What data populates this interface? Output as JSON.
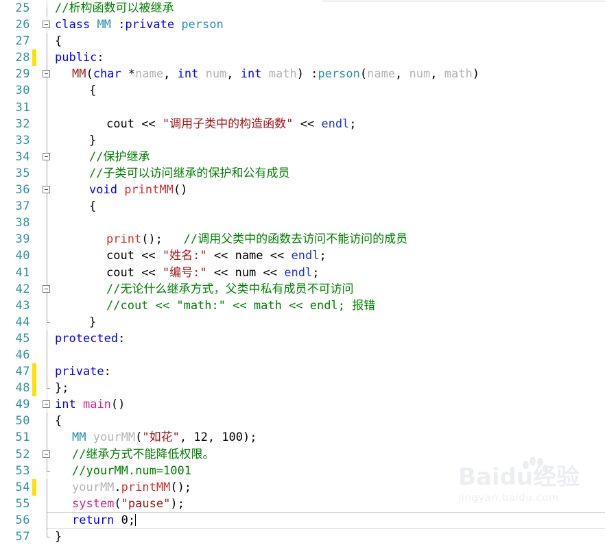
{
  "app": {
    "type": "code-editor",
    "language": "C++",
    "theme": "visual-studio-light"
  },
  "colors": {
    "keyword": "#0000FF",
    "comment": "#008000",
    "string": "#A31515",
    "user_type": "#2B91AF",
    "identifier_gray": "#B4B4B4",
    "member_function": "#D63030",
    "magenta_function": "#D2228D",
    "line_number": "#2B91AF",
    "change_bar": "#FFE100",
    "background": "#FFFFFF",
    "plain_text": "#000000"
  },
  "editor": {
    "first_line": 25,
    "last_line": 57,
    "current_line": 56,
    "caret_line": 56,
    "caret_after_text": "return 0;"
  },
  "lines": [
    {
      "num": "25",
      "fold": "none",
      "rail": "half-bot",
      "changed": false,
      "indent": 0,
      "tokens": [
        {
          "t": "//析构函数可以被继承",
          "c": "cmt"
        }
      ]
    },
    {
      "num": "26",
      "fold": "box",
      "rail": "none",
      "changed": false,
      "indent": 0,
      "tokens": [
        {
          "t": "class",
          "c": "kw"
        },
        {
          "t": " ",
          "c": "pln"
        },
        {
          "t": "MM",
          "c": "typ"
        },
        {
          "t": " :",
          "c": "pln"
        },
        {
          "t": "private",
          "c": "kw"
        },
        {
          "t": " ",
          "c": "pln"
        },
        {
          "t": "person",
          "c": "typ"
        }
      ]
    },
    {
      "num": "27",
      "fold": "line",
      "rail": "full",
      "changed": false,
      "indent": 0,
      "tokens": [
        {
          "t": "{",
          "c": "pln"
        }
      ]
    },
    {
      "num": "28",
      "fold": "line",
      "rail": "full",
      "changed": true,
      "indent": 0,
      "tokens": [
        {
          "t": "public",
          "c": "kw"
        },
        {
          "t": ":",
          "c": "pln"
        }
      ]
    },
    {
      "num": "29",
      "fold": "box",
      "rail": "full",
      "changed": false,
      "indent": 1,
      "tokens": [
        {
          "t": "MM",
          "c": "cls"
        },
        {
          "t": "(",
          "c": "pln"
        },
        {
          "t": "char",
          "c": "kw"
        },
        {
          "t": " *",
          "c": "pln"
        },
        {
          "t": "name",
          "c": "typ2"
        },
        {
          "t": ", ",
          "c": "pln"
        },
        {
          "t": "int",
          "c": "kw"
        },
        {
          "t": " ",
          "c": "pln"
        },
        {
          "t": "num",
          "c": "typ2"
        },
        {
          "t": ", ",
          "c": "pln"
        },
        {
          "t": "int",
          "c": "kw"
        },
        {
          "t": " ",
          "c": "pln"
        },
        {
          "t": "math",
          "c": "typ2"
        },
        {
          "t": ") :",
          "c": "pln"
        },
        {
          "t": "person",
          "c": "typ"
        },
        {
          "t": "(",
          "c": "pln"
        },
        {
          "t": "name",
          "c": "typ2"
        },
        {
          "t": ", ",
          "c": "pln"
        },
        {
          "t": "num",
          "c": "typ2"
        },
        {
          "t": ", ",
          "c": "pln"
        },
        {
          "t": "math",
          "c": "typ2"
        },
        {
          "t": ")",
          "c": "pln"
        }
      ]
    },
    {
      "num": "30",
      "fold": "line",
      "rail": "full",
      "changed": false,
      "indent": 2,
      "tokens": [
        {
          "t": "{",
          "c": "pln"
        }
      ]
    },
    {
      "num": "31",
      "fold": "line",
      "rail": "full",
      "changed": false,
      "indent": 0,
      "tokens": []
    },
    {
      "num": "32",
      "fold": "line",
      "rail": "full",
      "changed": false,
      "indent": 3,
      "tokens": [
        {
          "t": "cout",
          "c": "pln"
        },
        {
          "t": " << ",
          "c": "pln"
        },
        {
          "t": "\"调用子类中的构造函数\"",
          "c": "str"
        },
        {
          "t": " << ",
          "c": "pln"
        },
        {
          "t": "endl",
          "c": "blu"
        },
        {
          "t": ";",
          "c": "pln"
        }
      ]
    },
    {
      "num": "33",
      "fold": "line",
      "rail": "full",
      "changed": false,
      "indent": 2,
      "tokens": [
        {
          "t": "}",
          "c": "pln"
        }
      ]
    },
    {
      "num": "34",
      "fold": "box",
      "rail": "full",
      "changed": false,
      "indent": 2,
      "tokens": [
        {
          "t": "//保护继承",
          "c": "cmt"
        }
      ]
    },
    {
      "num": "35",
      "fold": "line",
      "rail": "full",
      "changed": false,
      "indent": 2,
      "tokens": [
        {
          "t": "//子类可以访问继承的保护和公有成员",
          "c": "cmt"
        }
      ]
    },
    {
      "num": "36",
      "fold": "box",
      "rail": "full",
      "changed": false,
      "indent": 2,
      "tokens": [
        {
          "t": "void",
          "c": "kw"
        },
        {
          "t": " ",
          "c": "pln"
        },
        {
          "t": "printMM",
          "c": "fn"
        },
        {
          "t": "()",
          "c": "pln"
        }
      ]
    },
    {
      "num": "37",
      "fold": "line",
      "rail": "full",
      "changed": false,
      "indent": 2,
      "tokens": [
        {
          "t": "{",
          "c": "pln"
        }
      ]
    },
    {
      "num": "38",
      "fold": "line",
      "rail": "full",
      "changed": false,
      "indent": 0,
      "tokens": []
    },
    {
      "num": "39",
      "fold": "line",
      "rail": "full",
      "changed": false,
      "indent": 3,
      "tokens": [
        {
          "t": "print",
          "c": "fn"
        },
        {
          "t": "();",
          "c": "pln"
        },
        {
          "t": "   ",
          "c": "pln"
        },
        {
          "t": "//调用父类中的函数去访问不能访问的成员",
          "c": "cmt"
        }
      ]
    },
    {
      "num": "40",
      "fold": "line",
      "rail": "full",
      "changed": false,
      "indent": 3,
      "tokens": [
        {
          "t": "cout",
          "c": "pln"
        },
        {
          "t": " << ",
          "c": "pln"
        },
        {
          "t": "\"姓名:\"",
          "c": "str"
        },
        {
          "t": " << ",
          "c": "pln"
        },
        {
          "t": "name",
          "c": "pln"
        },
        {
          "t": " << ",
          "c": "pln"
        },
        {
          "t": "endl",
          "c": "blu"
        },
        {
          "t": ";",
          "c": "pln"
        }
      ]
    },
    {
      "num": "41",
      "fold": "line",
      "rail": "full",
      "changed": false,
      "indent": 3,
      "tokens": [
        {
          "t": "cout",
          "c": "pln"
        },
        {
          "t": " << ",
          "c": "pln"
        },
        {
          "t": "\"编号:\"",
          "c": "str"
        },
        {
          "t": " << ",
          "c": "pln"
        },
        {
          "t": "num",
          "c": "pln"
        },
        {
          "t": " << ",
          "c": "pln"
        },
        {
          "t": "endl",
          "c": "blu"
        },
        {
          "t": ";",
          "c": "pln"
        }
      ]
    },
    {
      "num": "42",
      "fold": "box",
      "rail": "full",
      "changed": false,
      "indent": 3,
      "tokens": [
        {
          "t": "//无论什么继承方式，父类中私有成员不可访问",
          "c": "cmt"
        }
      ]
    },
    {
      "num": "43",
      "fold": "line",
      "rail": "full",
      "changed": false,
      "indent": 3,
      "tokens": [
        {
          "t": "//cout << \"math:\" << math << endl; 报错",
          "c": "cmt"
        }
      ]
    },
    {
      "num": "44",
      "fold": "line",
      "rail": "half-top",
      "changed": false,
      "indent": 2,
      "tokens": [
        {
          "t": "}",
          "c": "pln"
        }
      ]
    },
    {
      "num": "45",
      "fold": "line",
      "rail": "full",
      "changed": false,
      "indent": 0,
      "tokens": [
        {
          "t": "protected",
          "c": "kw"
        },
        {
          "t": ":",
          "c": "pln"
        }
      ]
    },
    {
      "num": "46",
      "fold": "line",
      "rail": "full",
      "changed": false,
      "indent": 0,
      "tokens": []
    },
    {
      "num": "47",
      "fold": "line",
      "rail": "full",
      "changed": true,
      "indent": 0,
      "tokens": [
        {
          "t": "private",
          "c": "kw"
        },
        {
          "t": ":",
          "c": "pln"
        }
      ]
    },
    {
      "num": "48",
      "fold": "line",
      "rail": "half-top",
      "changed": true,
      "indent": 0,
      "tokens": [
        {
          "t": "};",
          "c": "pln"
        }
      ]
    },
    {
      "num": "49",
      "fold": "box",
      "rail": "none",
      "changed": false,
      "indent": 0,
      "tokens": [
        {
          "t": "int",
          "c": "kw"
        },
        {
          "t": " ",
          "c": "pln"
        },
        {
          "t": "main",
          "c": "mag"
        },
        {
          "t": "()",
          "c": "pln"
        }
      ]
    },
    {
      "num": "50",
      "fold": "line",
      "rail": "full",
      "changed": false,
      "indent": 0,
      "tokens": [
        {
          "t": "{",
          "c": "pln"
        }
      ]
    },
    {
      "num": "51",
      "fold": "line",
      "rail": "full",
      "changed": false,
      "indent": 1,
      "tokens": [
        {
          "t": "MM",
          "c": "typ"
        },
        {
          "t": " ",
          "c": "pln"
        },
        {
          "t": "yourMM",
          "c": "typ2"
        },
        {
          "t": "(",
          "c": "pln"
        },
        {
          "t": "\"如花\"",
          "c": "str"
        },
        {
          "t": ", 12, 100);",
          "c": "pln"
        }
      ]
    },
    {
      "num": "52",
      "fold": "box",
      "rail": "full",
      "changed": false,
      "indent": 1,
      "tokens": [
        {
          "t": "//继承方式不能降低权限。",
          "c": "cmt"
        }
      ]
    },
    {
      "num": "53",
      "fold": "line",
      "rail": "half-top",
      "changed": false,
      "indent": 1,
      "tokens": [
        {
          "t": "//yourMM.num=1001",
          "c": "cmt"
        }
      ]
    },
    {
      "num": "54",
      "fold": "line",
      "rail": "full",
      "changed": true,
      "indent": 1,
      "tokens": [
        {
          "t": "yourMM",
          "c": "typ2"
        },
        {
          "t": ".",
          "c": "pln"
        },
        {
          "t": "printMM",
          "c": "fn"
        },
        {
          "t": "();",
          "c": "pln"
        }
      ]
    },
    {
      "num": "55",
      "fold": "line",
      "rail": "full",
      "changed": false,
      "indent": 1,
      "tokens": [
        {
          "t": "system",
          "c": "mag"
        },
        {
          "t": "(",
          "c": "pln"
        },
        {
          "t": "\"pause\"",
          "c": "str"
        },
        {
          "t": ");",
          "c": "pln"
        }
      ]
    },
    {
      "num": "56",
      "fold": "line",
      "rail": "full",
      "changed": false,
      "indent": 1,
      "current": true,
      "tokens": [
        {
          "t": "return",
          "c": "kw"
        },
        {
          "t": " 0;",
          "c": "pln"
        }
      ]
    },
    {
      "num": "57",
      "fold": "line",
      "rail": "half-top",
      "changed": false,
      "indent": 0,
      "tokens": [
        {
          "t": "}",
          "c": "pln"
        }
      ]
    }
  ],
  "watermark": {
    "brand": "Bai",
    "brand2": "du",
    "suffix": "经验",
    "url": "jingyan.baidu.com"
  }
}
